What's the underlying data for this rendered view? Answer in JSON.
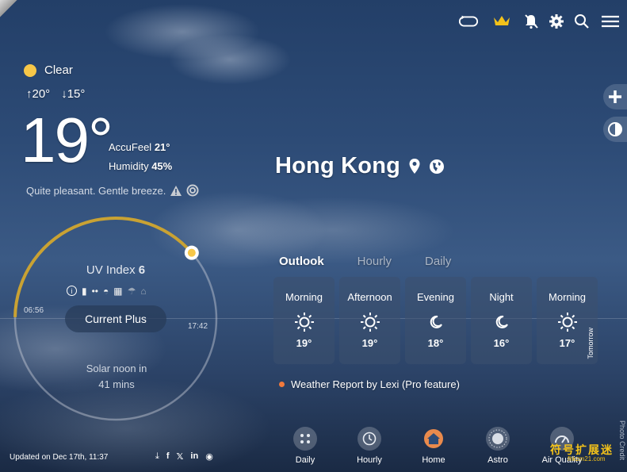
{
  "current": {
    "condition": "Clear",
    "high": "20°",
    "low": "15°",
    "temp": "19°",
    "accufeel_label": "AccuFeel",
    "accufeel_value": "21°",
    "humidity_label": "Humidity",
    "humidity_value": "45%",
    "summary": "Quite pleasant. Gentle breeze."
  },
  "location": {
    "city": "Hong Kong"
  },
  "uv": {
    "title": "UV Index",
    "value": "6",
    "progress_fraction": 0.33,
    "sunrise": "06:56",
    "sunset": "17:42",
    "button_label": "Current Plus",
    "noon_line1": "Solar noon in",
    "noon_line2": "41 mins"
  },
  "tabs": [
    {
      "label": "Outlook",
      "active": true
    },
    {
      "label": "Hourly",
      "active": false
    },
    {
      "label": "Daily",
      "active": false
    }
  ],
  "forecast": [
    {
      "label": "Morning",
      "icon": "sun-icon",
      "temp": "19°"
    },
    {
      "label": "Afternoon",
      "icon": "sun-icon",
      "temp": "19°"
    },
    {
      "label": "Evening",
      "icon": "moon-icon",
      "temp": "18°"
    },
    {
      "label": "Night",
      "icon": "moon-icon",
      "temp": "16°"
    },
    {
      "label": "Morning",
      "icon": "sun-icon",
      "temp": "17°",
      "tag": "Tomorrow"
    }
  ],
  "lexi": "Weather Report by Lexi (Pro feature)",
  "nav": [
    {
      "label": "Daily",
      "icon": "grid-icon"
    },
    {
      "label": "Hourly",
      "icon": "clock-icon"
    },
    {
      "label": "Home",
      "icon": "home-icon"
    },
    {
      "label": "Astro",
      "icon": "sun-ring-icon"
    },
    {
      "label": "Air Quality",
      "icon": "gauge-icon"
    }
  ],
  "footer": {
    "updated": "Updated on Dec 17th, 11:37",
    "watermark": "符号扩展迷",
    "watermark_sub": "fhkzm21.com",
    "photo_credit": "Photo Credit"
  },
  "colors": {
    "accent_sun": "#f7c748",
    "uv_arc": "#c9a233",
    "lexi_dot": "#f27a3c",
    "crown": "#f3c21a"
  }
}
